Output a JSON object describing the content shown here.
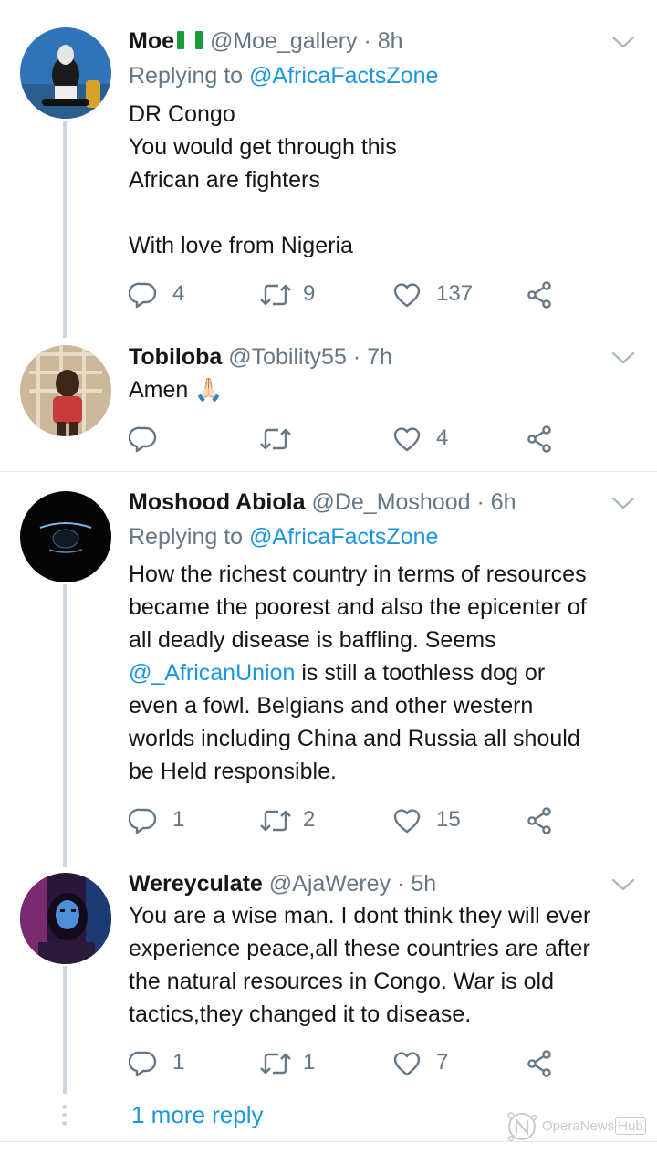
{
  "tweets": [
    {
      "name": "Moe",
      "flag": "nigeria-flag",
      "handle": "@Moe_gallery",
      "time": "· 8h",
      "replying_prefix": "Replying to ",
      "replying_to": "@AfricaFactsZone",
      "lines": [
        "DR Congo",
        "You would get through this",
        "African are fighters",
        "",
        "With love from Nigeria"
      ],
      "reply_count": "4",
      "retweet_count": "9",
      "like_count": "137"
    },
    {
      "name": "Tobiloba",
      "handle": "@Tobility55",
      "time": "· 7h",
      "text": "Amen",
      "emoji": "🙏🏻",
      "reply_count": "",
      "retweet_count": "",
      "like_count": "4"
    },
    {
      "name": "Moshood Abiola",
      "handle": "@De_Moshood",
      "time": "· 6h",
      "replying_prefix": "Replying to ",
      "replying_to": "@AfricaFactsZone",
      "lines": [
        "How the richest country in terms of resources",
        "became the poorest and also the epicenter of",
        "all deadly disease is baffling. Seems"
      ],
      "mention": "@_AfricanUnion",
      "mention_after": " is still a toothless dog or",
      "lines_after": [
        "even a fowl. Belgians and other western",
        "worlds including China and Russia all should",
        "be Held responsible."
      ],
      "reply_count": "1",
      "retweet_count": "2",
      "like_count": "15"
    },
    {
      "name": "Wereyculate",
      "handle": "@AjaWerey",
      "time": "· 5h",
      "lines": [
        "You are a wise man. I dont think they will ever",
        "experience peace,all these countries are after",
        "the natural resources in Congo. War is old",
        "tactics,they changed it to disease."
      ],
      "reply_count": "1",
      "retweet_count": "1",
      "like_count": "7"
    }
  ],
  "more_replies": "1 more reply",
  "watermark": {
    "text": "OperaNews",
    "badge": "Hub"
  },
  "colors": {
    "link": "#1b95e0",
    "muted": "#657786",
    "thread_line": "#ccd6dd",
    "divider": "#e1e8ed"
  },
  "icons": [
    "chevron-down-icon",
    "reply-icon",
    "retweet-icon",
    "like-icon",
    "share-icon"
  ]
}
